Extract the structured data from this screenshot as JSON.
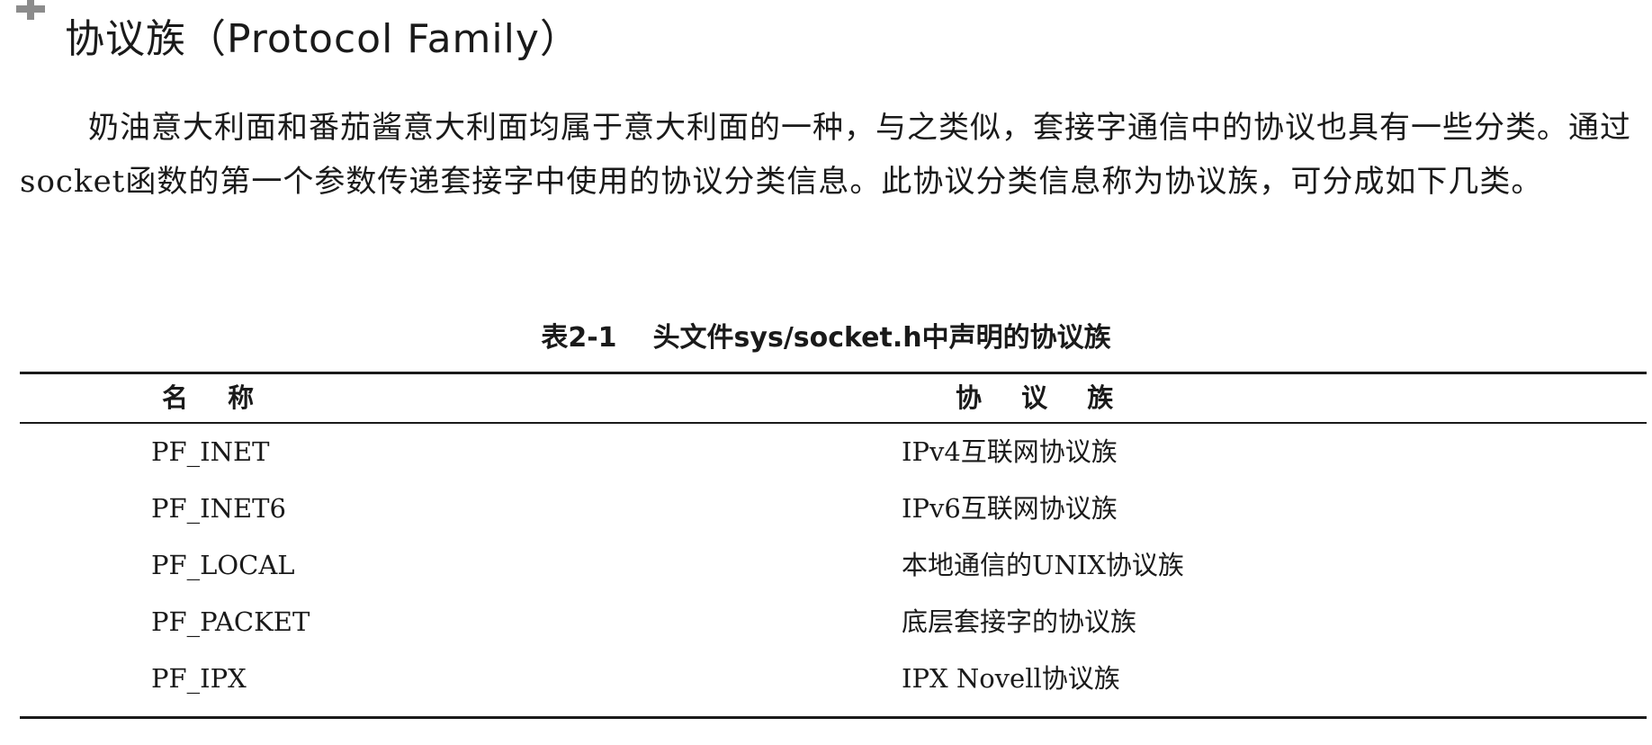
{
  "heading": {
    "text": "协议族（Protocol Family）"
  },
  "paragraph": {
    "text": "奶油意大利面和番茄酱意大利面均属于意大利面的一种，与之类似，套接字通信中的协议也具有一些分类。通过socket函数的第一个参数传递套接字中使用的协议分类信息。此协议分类信息称为协议族，可分成如下几类。"
  },
  "table": {
    "caption_no": "表2-1",
    "caption_title": "头文件sys/socket.h中声明的协议族",
    "headers": [
      "名 称",
      "协 议 族"
    ],
    "rows": [
      {
        "name": "PF_INET",
        "family": "IPv4互联网协议族"
      },
      {
        "name": "PF_INET6",
        "family": "IPv6互联网协议族"
      },
      {
        "name": "PF_LOCAL",
        "family": "本地通信的UNIX协议族"
      },
      {
        "name": "PF_PACKET",
        "family": "底层套接字的协议族"
      },
      {
        "name": "PF_IPX",
        "family": "IPX Novell协议族"
      }
    ]
  },
  "colors": {
    "text": "#1a1a1a",
    "heading_mark": "#8c8c8c"
  }
}
